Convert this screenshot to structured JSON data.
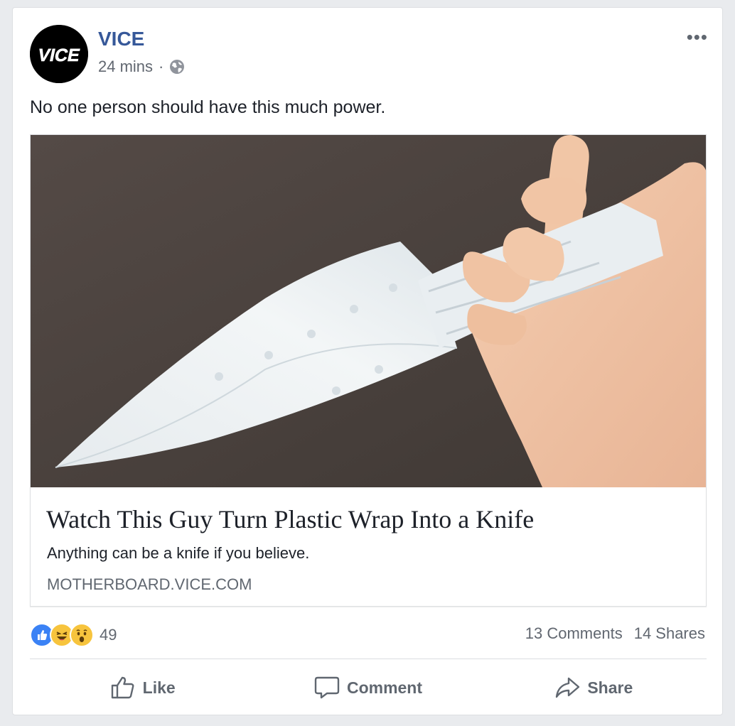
{
  "post": {
    "page_name": "VICE",
    "timestamp": "24 mins",
    "separator": "·",
    "privacy_icon": "globe-icon",
    "more_icon": "more-options-icon",
    "more_label": "•••",
    "message": "No one person should have this much power.",
    "avatar_logo": "VICE"
  },
  "link_preview": {
    "title": "Watch This Guy Turn Plastic Wrap Into a Knife",
    "description": "Anything can be a knife if you believe.",
    "domain": "MOTHERBOARD.VICE.COM"
  },
  "engagement": {
    "reactions": [
      "like-reaction-icon",
      "haha-reaction-icon",
      "wow-reaction-icon"
    ],
    "reaction_count": "49",
    "comments": "13 Comments",
    "shares": "14 Shares"
  },
  "actions": {
    "like": "Like",
    "comment": "Comment",
    "share": "Share"
  },
  "colors": {
    "page_name": "#365899",
    "secondary_text": "#616770",
    "background": "#e9ebee",
    "like_blue": "#3b82f5",
    "emoji_yellow": "#f7c43d"
  }
}
